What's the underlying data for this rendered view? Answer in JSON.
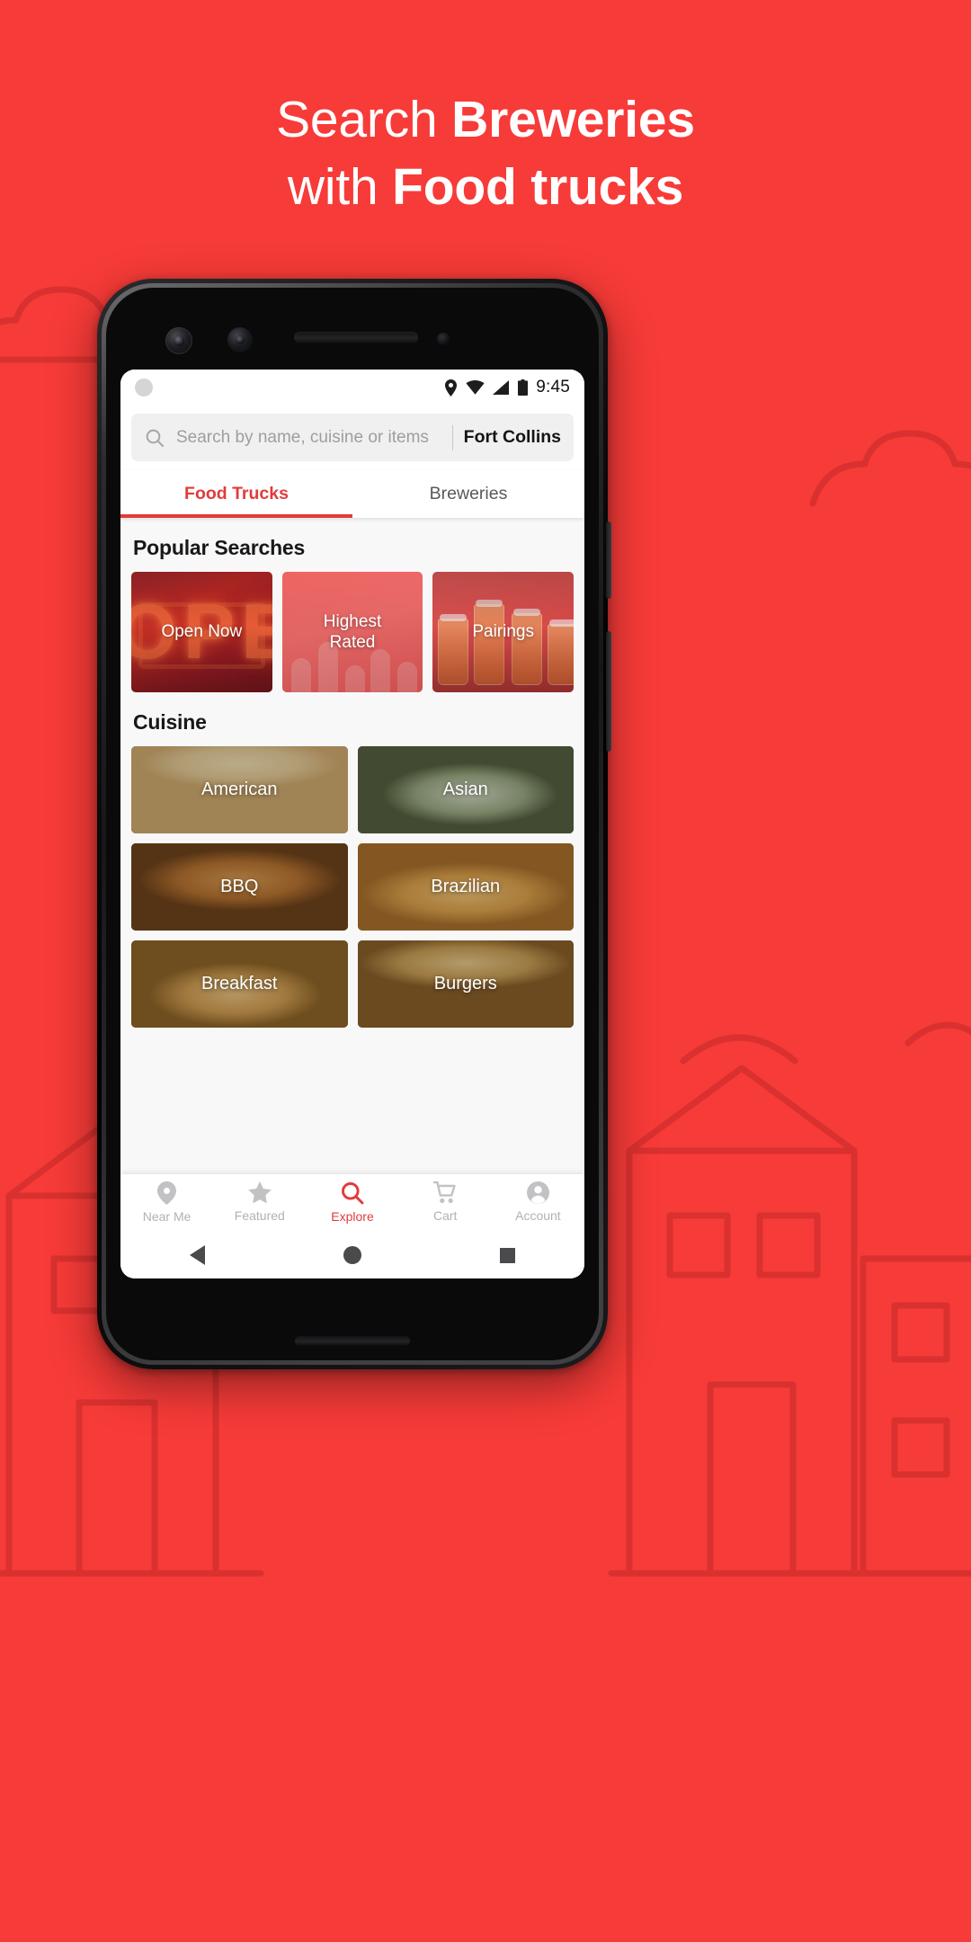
{
  "theme": {
    "background_red": "#F73B38",
    "accent_red": "#E23B3B",
    "white": "#FFFFFF"
  },
  "headline": {
    "line1_thin": "Search ",
    "line1_bold": "Breweries",
    "line2_thin": "with ",
    "line2_bold": "Food trucks"
  },
  "statusbar": {
    "time": "9:45",
    "icons": [
      "location-pin-icon",
      "wifi-icon",
      "cell-signal-icon",
      "battery-icon"
    ]
  },
  "search": {
    "placeholder": "Search by name, cuisine or items",
    "value": "",
    "city": "Fort Collins",
    "icon": "search-icon"
  },
  "tabs": [
    {
      "label": "Food Trucks",
      "active": true
    },
    {
      "label": "Breweries",
      "active": false
    }
  ],
  "popular_searches": {
    "title": "Popular Searches",
    "cards": [
      {
        "label": "Open Now",
        "art": "neon-open-sign",
        "neon_text": "OPE"
      },
      {
        "label": "Highest\nRated",
        "label_line1": "Highest",
        "label_line2": "Rated",
        "art": "raised-hands"
      },
      {
        "label": "Pairings",
        "art": "beer-glasses"
      }
    ]
  },
  "cuisine": {
    "title": "Cuisine",
    "items": [
      {
        "label": "American",
        "art": "sandwich-photo"
      },
      {
        "label": "Asian",
        "art": "noodle-bowl-photo"
      },
      {
        "label": "BBQ",
        "art": "pulled-pork-sandwich-photo"
      },
      {
        "label": "Brazilian",
        "art": "coxinha-photo"
      },
      {
        "label": "Breakfast",
        "art": "pancakes-photo"
      },
      {
        "label": "Burgers",
        "art": "burger-photo"
      }
    ]
  },
  "bottom_nav": [
    {
      "label": "Near Me",
      "icon": "location-pin-icon",
      "active": false
    },
    {
      "label": "Featured",
      "icon": "star-icon",
      "active": false
    },
    {
      "label": "Explore",
      "icon": "search-icon",
      "active": true
    },
    {
      "label": "Cart",
      "icon": "shopping-cart-icon",
      "active": false
    },
    {
      "label": "Account",
      "icon": "person-circle-icon",
      "active": false
    }
  ],
  "android_nav": [
    {
      "name": "back-button"
    },
    {
      "name": "home-button"
    },
    {
      "name": "recents-button"
    }
  ]
}
